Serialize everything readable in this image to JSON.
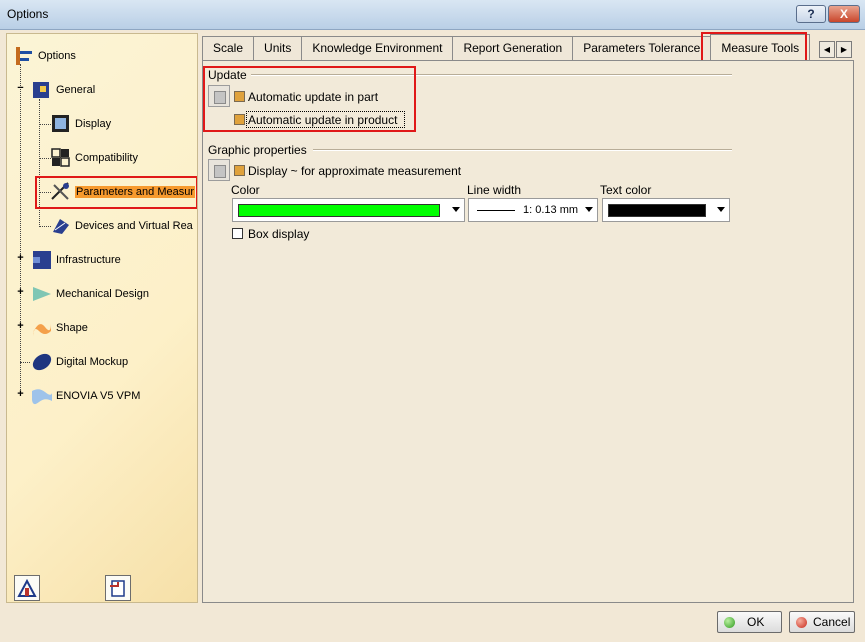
{
  "window": {
    "title": "Options",
    "help_label": "?",
    "close_label": "X"
  },
  "tree": {
    "items": [
      {
        "label": "Options",
        "icon": "options-icon"
      },
      {
        "label": "General",
        "icon": "general-icon"
      },
      {
        "label": "Display",
        "icon": "display-icon"
      },
      {
        "label": "Compatibility",
        "icon": "compatibility-icon"
      },
      {
        "label": "Parameters and Measur",
        "icon": "parameters-icon",
        "selected": true
      },
      {
        "label": "Devices and Virtual Rea",
        "icon": "devices-icon"
      },
      {
        "label": "Infrastructure",
        "icon": "infrastructure-icon"
      },
      {
        "label": "Mechanical Design",
        "icon": "mechanical-icon"
      },
      {
        "label": "Shape",
        "icon": "shape-icon"
      },
      {
        "label": "Digital Mockup",
        "icon": "mockup-icon"
      },
      {
        "label": "ENOVIA V5 VPM",
        "icon": "enovia-icon"
      }
    ]
  },
  "tabs": [
    {
      "label": "Scale"
    },
    {
      "label": "Units"
    },
    {
      "label": "Knowledge Environment"
    },
    {
      "label": "Report Generation"
    },
    {
      "label": "Parameters Tolerance"
    },
    {
      "label": "Measure Tools",
      "active": true
    }
  ],
  "update": {
    "title": "Update",
    "auto_part": "Automatic update in part",
    "auto_product": "Automatic update in product"
  },
  "graphic": {
    "title": "Graphic properties",
    "display_approx": "Display ~ for approximate measurement",
    "color_label": "Color",
    "line_width_label": "Line width",
    "line_width_value": "1: 0.13 mm",
    "text_color_label": "Text color",
    "color_value": "#00ff00",
    "text_color_value": "#000000",
    "box_display": "Box display"
  },
  "buttons": {
    "ok": "OK",
    "cancel": "Cancel"
  }
}
